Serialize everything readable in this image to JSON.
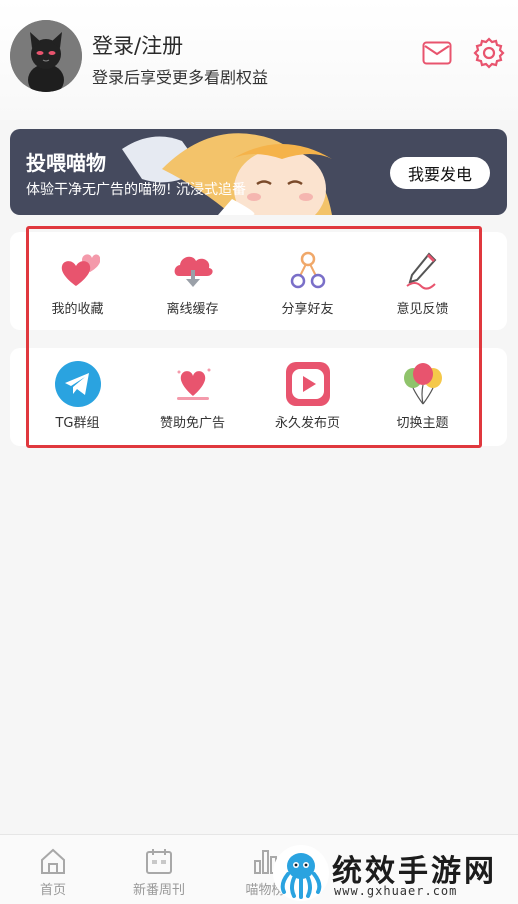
{
  "header": {
    "login_title": "登录/注册",
    "login_subtitle": "登录后享受更多看剧权益"
  },
  "banner": {
    "title": "投喂喵物",
    "subtitle": "体验干净无广告的喵物! 沉浸式追番",
    "button_label": "我要发电"
  },
  "grid_row1": [
    {
      "label": "我的收藏",
      "icon": "hearts-icon"
    },
    {
      "label": "离线缓存",
      "icon": "cloud-download-icon"
    },
    {
      "label": "分享好友",
      "icon": "share-icon"
    },
    {
      "label": "意见反馈",
      "icon": "pen-icon"
    }
  ],
  "grid_row2": [
    {
      "label": "TG群组",
      "icon": "telegram-icon"
    },
    {
      "label": "赞助免广告",
      "icon": "heart-sponsor-icon"
    },
    {
      "label": "永久发布页",
      "icon": "play-icon"
    },
    {
      "label": "切换主题",
      "icon": "balloons-icon"
    }
  ],
  "bottom_nav": [
    {
      "label": "首页",
      "icon": "home-icon"
    },
    {
      "label": "新番周刊",
      "icon": "calendar-icon"
    },
    {
      "label": "喵物榜",
      "icon": "chart-icon"
    }
  ],
  "watermark": {
    "text": "统效手游网",
    "url": "www.gxhuaer.com"
  },
  "colors": {
    "banner_bg": "#454a5e",
    "accent_pink": "#e8546e",
    "highlight_red": "#e0383e",
    "telegram_blue": "#2aa3e0"
  }
}
